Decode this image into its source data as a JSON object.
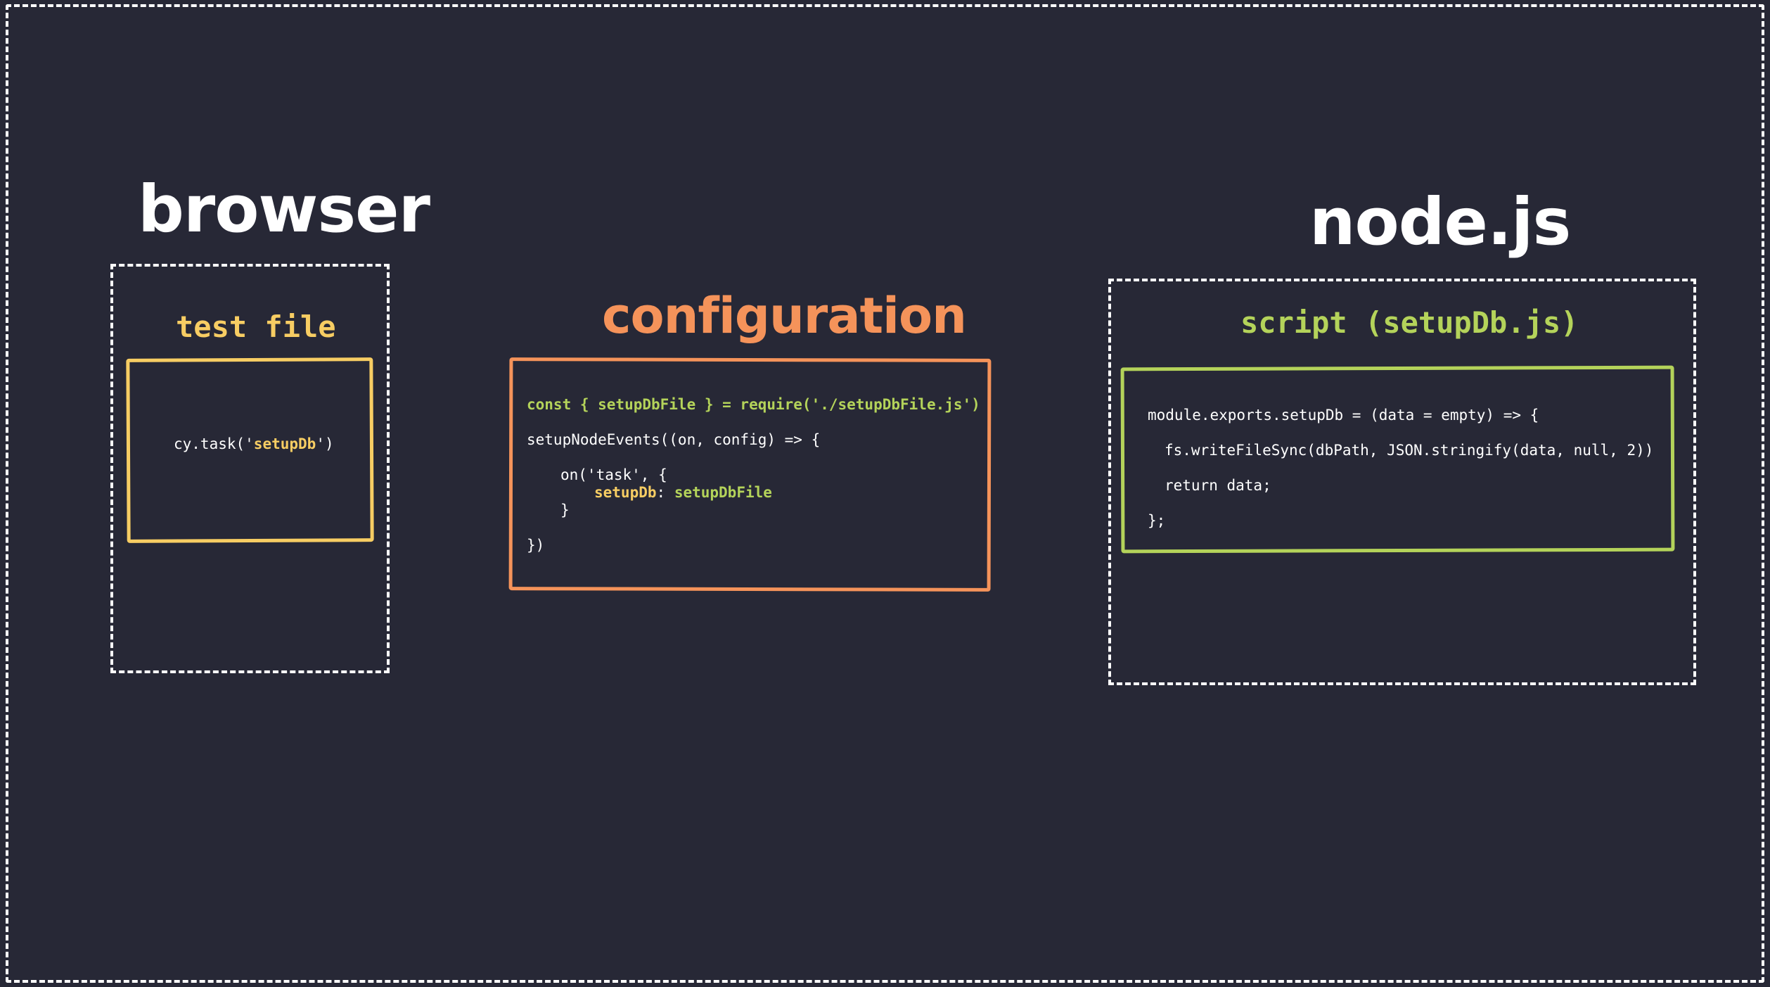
{
  "titles": {
    "browser": "browser",
    "configuration": "configuration",
    "node": "node.js"
  },
  "browser": {
    "box_title": "test file",
    "code": {
      "prefix": "cy.task('",
      "task_name": "setupDb",
      "suffix": "')"
    }
  },
  "configuration": {
    "line1": "const { setupDbFile } = require('./setupDbFile.js')",
    "line2": "setupNodeEvents((on, config) => {",
    "line3": "on('task', {",
    "line4_key": "setupDb",
    "line4_sep": ": ",
    "line4_value": "setupDbFile",
    "line5": "}",
    "line6": "})"
  },
  "node": {
    "box_title": "script (setupDb.js)",
    "line1": "module.exports.setupDb = (data = empty) => {",
    "line2": "fs.writeFileSync(dbPath, JSON.stringify(data, null, 2))",
    "line3": "return data;",
    "line4": "};"
  },
  "colors": {
    "background": "#272836",
    "browser_accent": "#f7cd63",
    "configuration_accent": "#f5935a",
    "node_accent": "#b4d35a",
    "frame": "#ffffff"
  }
}
